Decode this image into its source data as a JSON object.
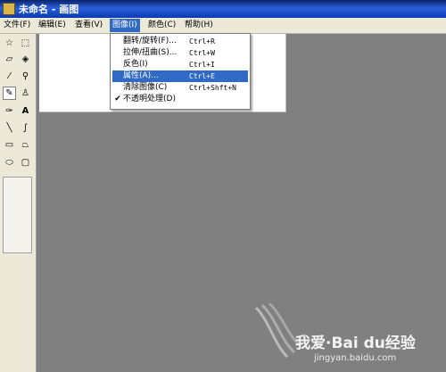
{
  "window": {
    "title": "未命名 - 画图"
  },
  "menubar": {
    "items": [
      {
        "label": "文件(F)"
      },
      {
        "label": "编辑(E)"
      },
      {
        "label": "查看(V)"
      },
      {
        "label": "图像(I)"
      },
      {
        "label": "颜色(C)"
      },
      {
        "label": "帮助(H)"
      }
    ]
  },
  "image_menu": {
    "items": [
      {
        "label": "翻转/旋转(F)...",
        "shortcut": "Ctrl+R",
        "checked": false,
        "highlighted": false
      },
      {
        "label": "拉伸/扭曲(S)...",
        "shortcut": "Ctrl+W",
        "checked": false,
        "highlighted": false
      },
      {
        "label": "反色(I)",
        "shortcut": "Ctrl+I",
        "checked": false,
        "highlighted": false
      },
      {
        "label": "属性(A)...",
        "shortcut": "Ctrl+E",
        "checked": false,
        "highlighted": true
      },
      {
        "label": "清除图像(C)",
        "shortcut": "Ctrl+Shft+N",
        "checked": false,
        "highlighted": false
      },
      {
        "label": "不透明处理(D)",
        "shortcut": "",
        "checked": true,
        "highlighted": false
      }
    ],
    "check_glyph": "✔"
  },
  "toolbox": {
    "tools": [
      {
        "name": "free-select",
        "glyph": "☆"
      },
      {
        "name": "select",
        "glyph": "⬚"
      },
      {
        "name": "eraser",
        "glyph": "▱"
      },
      {
        "name": "fill",
        "glyph": "◈"
      },
      {
        "name": "pick-color",
        "glyph": "⁄"
      },
      {
        "name": "magnifier",
        "glyph": "⚲"
      },
      {
        "name": "pencil",
        "glyph": "✎"
      },
      {
        "name": "brush",
        "glyph": "♙"
      },
      {
        "name": "airbrush",
        "glyph": "✑"
      },
      {
        "name": "text",
        "glyph": "A"
      },
      {
        "name": "line",
        "glyph": "╲"
      },
      {
        "name": "curve",
        "glyph": "∫"
      },
      {
        "name": "rectangle",
        "glyph": "▭"
      },
      {
        "name": "polygon",
        "glyph": "⏢"
      },
      {
        "name": "ellipse",
        "glyph": "⬭"
      },
      {
        "name": "rounded-rectangle",
        "glyph": "▢"
      }
    ]
  },
  "watermark": {
    "brand": "我爱·Bai du经验",
    "url": "jingyan.baidu.com"
  },
  "colors": {
    "highlight": "#316ac5",
    "menubar": "#ece9d8",
    "workspace": "#808080"
  }
}
